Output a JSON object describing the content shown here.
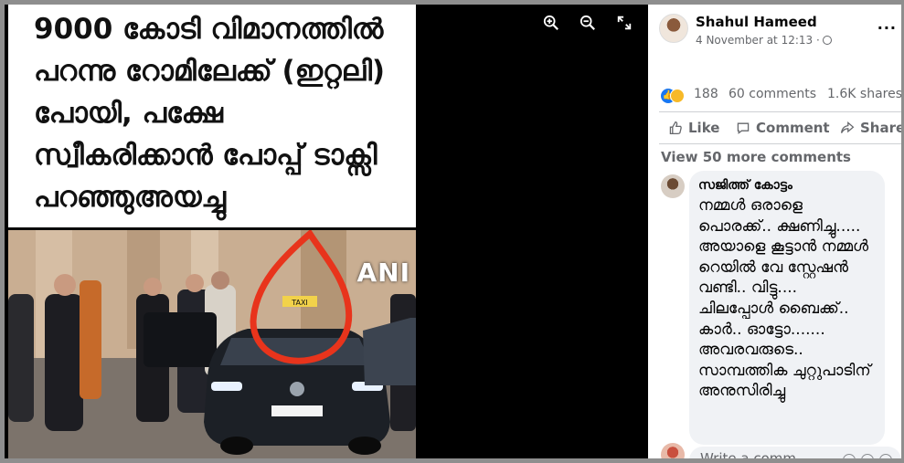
{
  "viewer": {
    "tools": [
      {
        "name": "zoom-in-icon"
      },
      {
        "name": "zoom-out-icon"
      },
      {
        "name": "fullscreen-icon"
      }
    ],
    "meme_title": "9000 കോടി വിമാനത്തിൽ പറന്നു റോമിലേക്ക് (ഇറ്റലി) പോയി, പക്ഷേ സ്വീകരിക്കാൻ പോപ്പ് ടാക്സി പറഞ്ഞുഅയച്ചു",
    "photo_badge": "ANI",
    "taxi_sign": "TAXI"
  },
  "post": {
    "author": "Shahul Hameed",
    "date": "4 November at 12:13 ·",
    "more_label": "···",
    "reactions_count": "188",
    "comments_count": "60 comments",
    "shares_count": "1.6K shares",
    "actions": {
      "like": "Like",
      "comment": "Comment",
      "share": "Share"
    },
    "view_more": "View 50 more comments",
    "comment": {
      "author": "സജിത്ത് കോട്ടം",
      "text": "നമ്മൾ ഒരാളെ പൊരക്ക്.. ക്ഷണിച്ചു..... അയാളെ കൂട്ടാൻ നമ്മൾ റെയിൽ വേ സ്റ്റേഷൻ വണ്ടി.. വിട്ടു.... ചിലപ്പോൾ ബൈക്ക്.. കാർ.. ഓട്ടോ....... അവരവരുടെ.. സാമ്പത്തിക ചുറ്റുപാടിന് അനുസിരിച്ചു"
    },
    "write_placeholder": "Write a comm..."
  },
  "colors": {
    "accent": "#1877f2",
    "muted_text": "#65676b",
    "bubble": "#f0f2f5",
    "annotation_ring": "#e8341c"
  }
}
